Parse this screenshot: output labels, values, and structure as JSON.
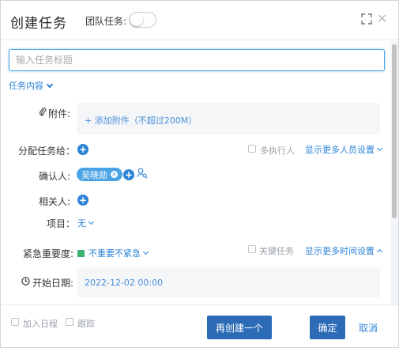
{
  "header": {
    "title": "创建任务",
    "team_task_label": "团队任务:",
    "team_task_on": false
  },
  "form": {
    "title_placeholder": "输入任务标题",
    "section_toggle": "任务内容",
    "attachment": {
      "label": "附件:",
      "add_link": "+ 添加附件（不超过200M）"
    },
    "assign": {
      "label": "分配任务给：",
      "multi_executor": "多执行人",
      "more_people": "显示更多人员设置"
    },
    "confirm": {
      "label": "确认人:",
      "person": "吴晓勋"
    },
    "related": {
      "label": "相关人:"
    },
    "project": {
      "label": "项目：",
      "value": "无"
    },
    "priority": {
      "label": "紧急重要度:",
      "value": "不重要不紧急",
      "color": "#3cb371",
      "key_task": "关键任务",
      "more_time": "显示更多时间设置"
    },
    "start_date": {
      "label": "开始日期:",
      "value": "2022-12-02 00:00"
    }
  },
  "footer": {
    "add_schedule": "加入日程",
    "follow": "跟踪",
    "create_another": "再创建一个",
    "confirm": "确定",
    "cancel": "取消"
  },
  "colors": {
    "accent": "#2b83d6",
    "primary_button": "#2c6cb7"
  }
}
